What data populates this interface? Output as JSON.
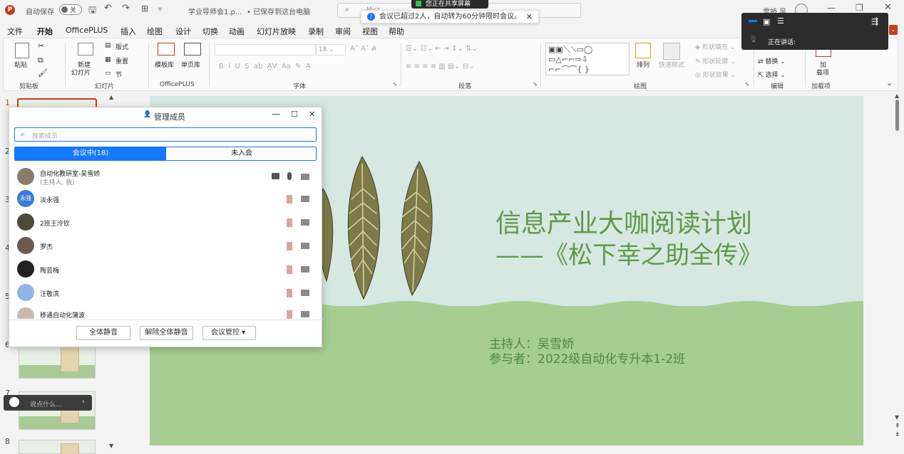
{
  "titlebar": {
    "autosave_label": "自动保存",
    "autosave_state": "关",
    "filename": "学业导师会1.p...",
    "save_status": "• 已保存到这台电脑",
    "search_placeholder": "Micr...",
    "user": "雪娇 吴"
  },
  "share_banner": "您正在共享屏幕",
  "meeting_toast": "会议已超过2人，自动转为60分钟限时会议。",
  "menu": [
    "文件",
    "开始",
    "OfficePLUS",
    "插入",
    "绘图",
    "设计",
    "切换",
    "动画",
    "幻灯片放映",
    "录制",
    "审阅",
    "视图",
    "帮助"
  ],
  "ribbon": {
    "clipboard": {
      "paste": "粘贴",
      "group": "剪贴板"
    },
    "slides": {
      "new_slide": "新建",
      "new_slide2": "幻灯片",
      "layout": "版式",
      "reset": "重置",
      "section": "节",
      "group": "幻灯片"
    },
    "officeplus": {
      "template": "模板库",
      "single": "单页库",
      "group": "OfficePLUS"
    },
    "font": {
      "size": "18",
      "group": "字体"
    },
    "paragraph": {
      "group": "段落"
    },
    "drawing": {
      "arrange": "排列",
      "quick_styles": "快速样式",
      "fill": "形状填充",
      "outline": "形状轮廓",
      "effect": "形状效果",
      "group": "绘图"
    },
    "editing": {
      "replace": "替换",
      "select": "选择",
      "group": "编辑"
    },
    "addins": {
      "addin": "加",
      "addin2": "载项",
      "group": "加载项"
    }
  },
  "thumbnails": [
    "1",
    "2",
    "3",
    "4",
    "5",
    "6",
    "7",
    "8"
  ],
  "slide": {
    "title": "信息产业大咖阅读计划",
    "subtitle": "——《松下幸之助全传》",
    "host": "主持人：吴雪娇",
    "participants": "参与者：2022级自动化专升本1-2班"
  },
  "members": {
    "title": "管理成员",
    "search_placeholder": "搜索成员",
    "tab_in": "会议中(18)",
    "tab_out": "未入会",
    "list": [
      {
        "name": "自动化教研室-吴雪娇",
        "sub": "(主持人, 我)"
      },
      {
        "name": "淡永强",
        "avatar": "永强"
      },
      {
        "name": "2班王泠钦"
      },
      {
        "name": "罗杰"
      },
      {
        "name": "陶芸梅"
      },
      {
        "name": "汪敬滨"
      },
      {
        "name": "移通自动化蒲波"
      }
    ],
    "mute_all": "全体静音",
    "unmute_all": "解除全体静音",
    "control": "会议管控"
  },
  "speaking": {
    "label": "正在讲话:"
  },
  "chat": {
    "placeholder": "说点什么..."
  },
  "colors": {
    "accent": "#1677ff",
    "office_red": "#c43e1c",
    "slide_text": "#5f9a47"
  }
}
